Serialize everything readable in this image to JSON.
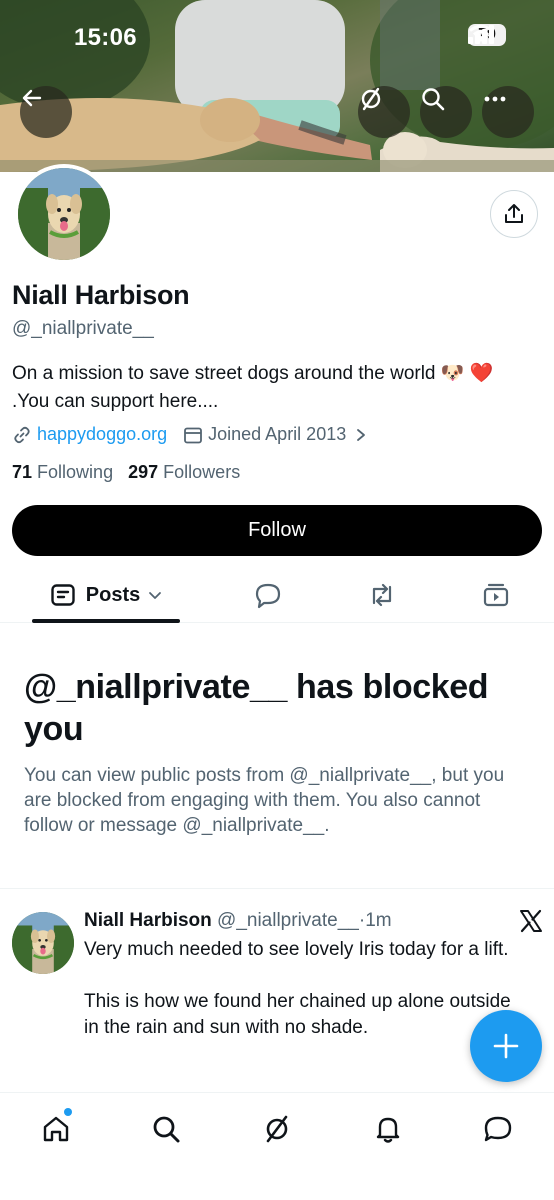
{
  "status_bar": {
    "time": "15:06",
    "battery": "79"
  },
  "profile": {
    "display_name": "Niall Harbison",
    "handle": "@_niallprivate__",
    "bio": "On a mission to save street dogs around the world 🐶 ❤️ .You can support here....",
    "link": "happydoggo.org",
    "joined": "Joined April 2013",
    "following_count": "71",
    "following_label": "Following",
    "followers_count": "297",
    "followers_label": "Followers",
    "follow_button": "Follow"
  },
  "tabs": {
    "posts_label": "Posts"
  },
  "blocked": {
    "title": "@_niallprivate__ has blocked you",
    "description": "You can view public posts from @_niallprivate__, but you are blocked from engaging with them. You also cannot follow or message @_niallprivate__."
  },
  "tweet": {
    "name": "Niall Harbison",
    "handle": "@_niallprivate__",
    "separator": "·",
    "time": "1m",
    "text": "Very much needed to see lovely Iris today for a lift.\n\nThis is how we found her chained up alone outside in the rain and sun with no shade."
  },
  "colors": {
    "accent": "#1d9bf0",
    "text": "#0f1419",
    "secondary": "#536471",
    "button": "#000000"
  },
  "icons": {
    "header": [
      "back-arrow-icon",
      "grok-icon",
      "search-icon",
      "more-icon"
    ],
    "share": "share-icon",
    "meta": [
      "link-icon",
      "calendar-icon"
    ],
    "tabs": [
      "posts-icon",
      "chevron-down-icon",
      "replies-icon",
      "repost-icon",
      "media-icon"
    ],
    "nav": [
      "home-icon",
      "search-icon",
      "grok-icon",
      "notifications-icon",
      "messages-icon"
    ],
    "fab": "plus-icon",
    "brand": "x-logo-icon"
  }
}
